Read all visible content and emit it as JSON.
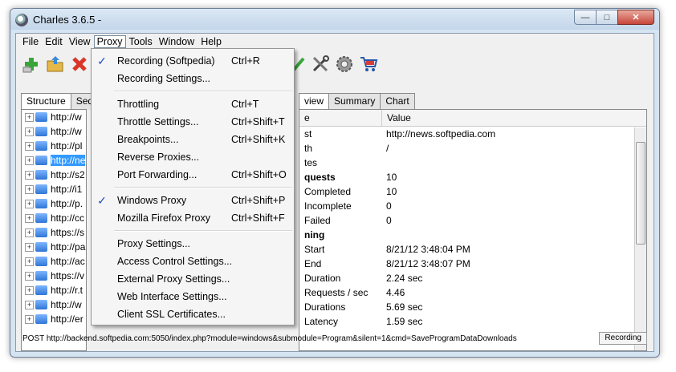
{
  "window": {
    "title": "Charles 3.6.5 -"
  },
  "menubar": [
    "File",
    "Edit",
    "View",
    "Proxy",
    "Tools",
    "Window",
    "Help"
  ],
  "menubar_active": "Proxy",
  "toolbar": {
    "icons": [
      "new-session-icon",
      "open-icon",
      "delete-icon",
      "validate-icon",
      "tools-icon",
      "settings-icon",
      "compose-icon"
    ]
  },
  "left_tabs": [
    "Structure",
    "Seq"
  ],
  "tree": [
    "http://w",
    "http://w",
    "http://pl",
    "http://ne",
    "http://s2",
    "http://i1",
    "http://p.",
    "http://cc",
    "https://s",
    "http://pa",
    "http://ac",
    "https://v",
    "http://r.t",
    "http://w",
    "http://er"
  ],
  "tree_selected_index": 3,
  "right_tabs": [
    "view",
    "Summary",
    "Chart"
  ],
  "table": {
    "headers": [
      "e",
      "Value"
    ],
    "rows": [
      {
        "name": "st",
        "value": "http://news.softpedia.com",
        "bold": false
      },
      {
        "name": "th",
        "value": "/",
        "bold": false
      },
      {
        "name": "tes",
        "value": "",
        "bold": false
      },
      {
        "name": "quests",
        "value": "10",
        "bold": true
      },
      {
        "name": "Completed",
        "value": "10",
        "bold": false
      },
      {
        "name": "Incomplete",
        "value": "0",
        "bold": false
      },
      {
        "name": "Failed",
        "value": "0",
        "bold": false
      },
      {
        "name": "ning",
        "value": "",
        "bold": true
      },
      {
        "name": "Start",
        "value": "8/21/12 3:48:04 PM",
        "bold": false
      },
      {
        "name": "End",
        "value": "8/21/12 3:48:07 PM",
        "bold": false
      },
      {
        "name": "Duration",
        "value": "2.24 sec",
        "bold": false
      },
      {
        "name": "Requests / sec",
        "value": "4.46",
        "bold": false
      },
      {
        "name": "Durations",
        "value": "5.69 sec",
        "bold": false
      },
      {
        "name": "Latency",
        "value": "1.59 sec",
        "bold": false
      }
    ]
  },
  "proxy_menu": [
    {
      "label": "Recording (Softpedia)",
      "shortcut": "Ctrl+R",
      "checked": true
    },
    {
      "label": "Recording Settings...",
      "shortcut": "",
      "checked": false
    },
    {
      "sep": true
    },
    {
      "label": "Throttling",
      "shortcut": "Ctrl+T",
      "checked": false
    },
    {
      "label": "Throttle Settings...",
      "shortcut": "Ctrl+Shift+T",
      "checked": false
    },
    {
      "label": "Breakpoints...",
      "shortcut": "Ctrl+Shift+K",
      "checked": false
    },
    {
      "label": "Reverse Proxies...",
      "shortcut": "",
      "checked": false
    },
    {
      "label": "Port Forwarding...",
      "shortcut": "Ctrl+Shift+O",
      "checked": false
    },
    {
      "sep": true
    },
    {
      "label": "Windows Proxy",
      "shortcut": "Ctrl+Shift+P",
      "checked": true
    },
    {
      "label": "Mozilla Firefox Proxy",
      "shortcut": "Ctrl+Shift+F",
      "checked": false
    },
    {
      "sep": true
    },
    {
      "label": "Proxy Settings...",
      "shortcut": "",
      "checked": false
    },
    {
      "label": "Access Control Settings...",
      "shortcut": "",
      "checked": false
    },
    {
      "label": "External Proxy Settings...",
      "shortcut": "",
      "checked": false
    },
    {
      "label": "Web Interface Settings...",
      "shortcut": "",
      "checked": false
    },
    {
      "label": "Client SSL Certificates...",
      "shortcut": "",
      "checked": false
    }
  ],
  "check_glyph": "✓",
  "status": {
    "text": "POST http://backend.softpedia.com:5050/index.php?module=windows&submodule=Program&silent=1&cmd=SaveProgramDataDownloads",
    "button": "Recording"
  },
  "colors": {
    "selection": "#3399ff",
    "check": "#1f4fbf"
  }
}
